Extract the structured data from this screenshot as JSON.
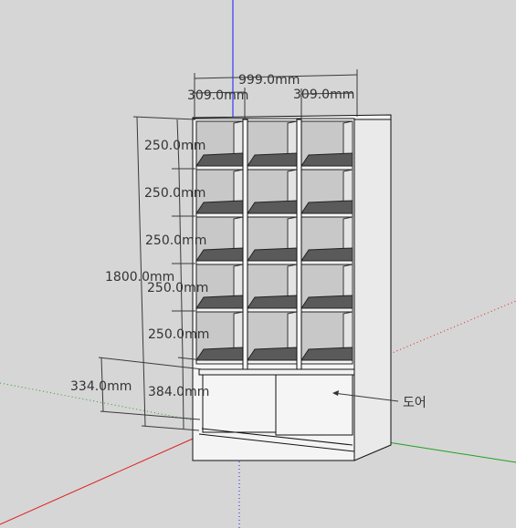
{
  "scene": {
    "background": "#d6d6d6",
    "axes": {
      "blue": "#1a1aff",
      "red": "#e02020",
      "green": "#20a020"
    }
  },
  "dimensions": {
    "overall_width": "999.0mm",
    "column_width_left": "309.0mm",
    "column_width_right": "309.0mm",
    "overall_height": "1800.0mm",
    "shelf_heights": [
      "250.0mm",
      "250.0mm",
      "250.0mm",
      "250.0mm",
      "250.0mm"
    ],
    "base_section_height": "384.0mm",
    "door_height": "334.0mm"
  },
  "labels": {
    "door": "도어"
  }
}
